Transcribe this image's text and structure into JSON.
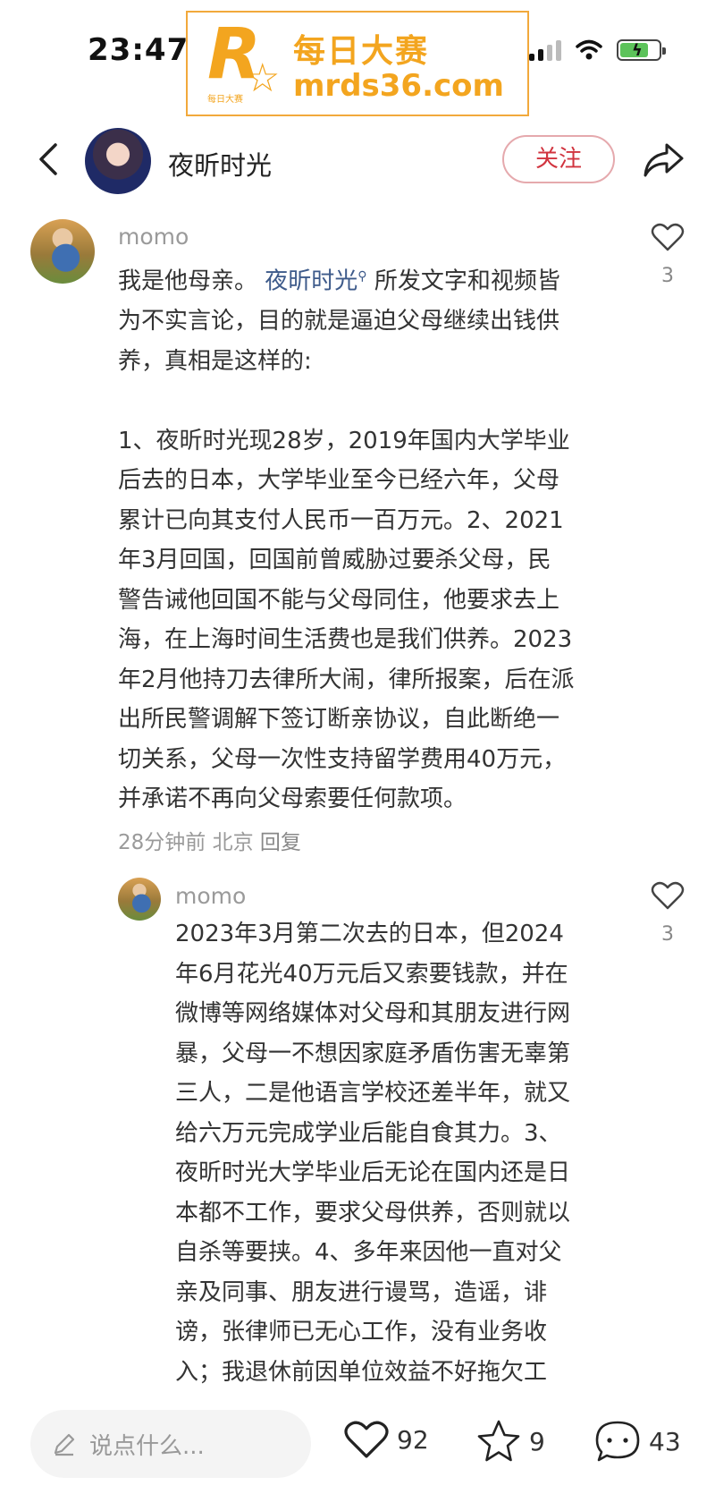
{
  "status_bar": {
    "time": "23:47"
  },
  "watermark": {
    "logo_letter": "R",
    "logo_sub": "每日大赛",
    "line1": "每日大赛",
    "line2": "mrds36.com"
  },
  "header": {
    "title": "夜昕时光",
    "follow_label": "关注"
  },
  "comment": {
    "username": "momo",
    "text_before": "我是他母亲。",
    "mention": "夜昕时光",
    "text_after": "所发文字和视频皆\n为不实言论，目的就是逼迫父母继续出钱供\n养，真相是这样的:\n\n1、夜昕时光现28岁，2019年国内大学毕业\n后去的日本，大学毕业至今已经六年，父母\n累计已向其支付人民币一百万元。2、2021\n年3月回国，回国前曾威胁过要杀父母，民\n警告诫他回国不能与父母同住，他要求去上\n海，在上海时间生活费也是我们供养。2023\n年2月他持刀去律所大闹，律所报案，后在派\n出所民警调解下签订断亲协议，自此断绝一\n切关系，父母一次性支持留学费用40万元，\n并承诺不再向父母索要任何款项。",
    "time": "28分钟前",
    "location": "北京",
    "reply_label": "回复",
    "likes": "3"
  },
  "reply": {
    "username": "momo",
    "text": "2023年3月第二次去的日本，但2024\n年6月花光40万元后又索要钱款，并在\n微博等网络媒体对父母和其朋友进行网\n暴，父母一不想因家庭矛盾伤害无辜第\n三人，二是他语言学校还差半年，就又\n给六万元完成学业后能自食其力。3、\n夜昕时光大学毕业后无论在国内还是日\n本都不工作，要求父母供养，否则就以\n自杀等要挟。4、多年来因他一直对父\n亲及同事、朋友进行谩骂，造谣，诽\n谤，张律师已无心工作，没有业务收\n入；我退休前因单位效益不好拖欠工",
    "likes": "3"
  },
  "bottom_bar": {
    "input_placeholder": "说点什么...",
    "like_count": "92",
    "favorite_count": "9",
    "comment_count": "43"
  },
  "colors": {
    "accent": "#d1343f",
    "watermark": "#f3a51f",
    "mention": "#3d5a8a"
  },
  "icons": [
    "back-icon",
    "share-icon",
    "heart-icon",
    "star-icon",
    "chat-icon",
    "pencil-icon",
    "wifi-icon",
    "battery-icon",
    "signal-icon"
  ]
}
